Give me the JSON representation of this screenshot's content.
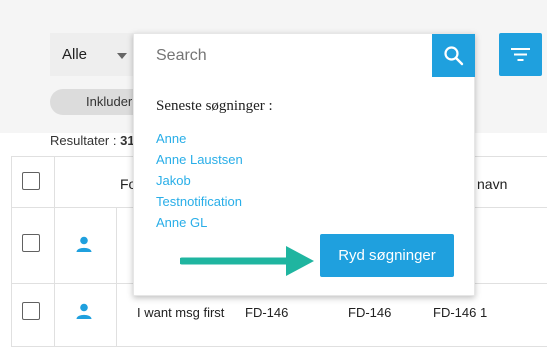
{
  "filter": {
    "selected": "Alle"
  },
  "toggle": {
    "label": "Inkluder"
  },
  "results": {
    "label": "Resultater :",
    "count_partial": "31"
  },
  "search": {
    "placeholder": "Search",
    "recent_title": "Seneste søgninger :",
    "recent": [
      "Anne",
      "Anne Laustsen",
      "Jakob",
      "Testnotification",
      "Anne GL"
    ],
    "clear_label": "Ryd søgninger"
  },
  "table": {
    "headers": {
      "first_partial": "Fo",
      "last": "navn"
    },
    "rows": [
      {
        "icon": "user-icon",
        "cells": []
      },
      {
        "icon": "user-icon",
        "cells": [
          "I want msg first",
          "FD-146",
          "FD-146",
          "FD-146 1"
        ]
      }
    ]
  },
  "colors": {
    "accent": "#1fa0de",
    "link": "#29aee8",
    "arrow": "#1fb5a0"
  },
  "icons": {
    "search": "search-icon",
    "filter": "filter-lines-icon",
    "caret": "chevron-down-icon",
    "arrow": "arrow-right-icon"
  }
}
